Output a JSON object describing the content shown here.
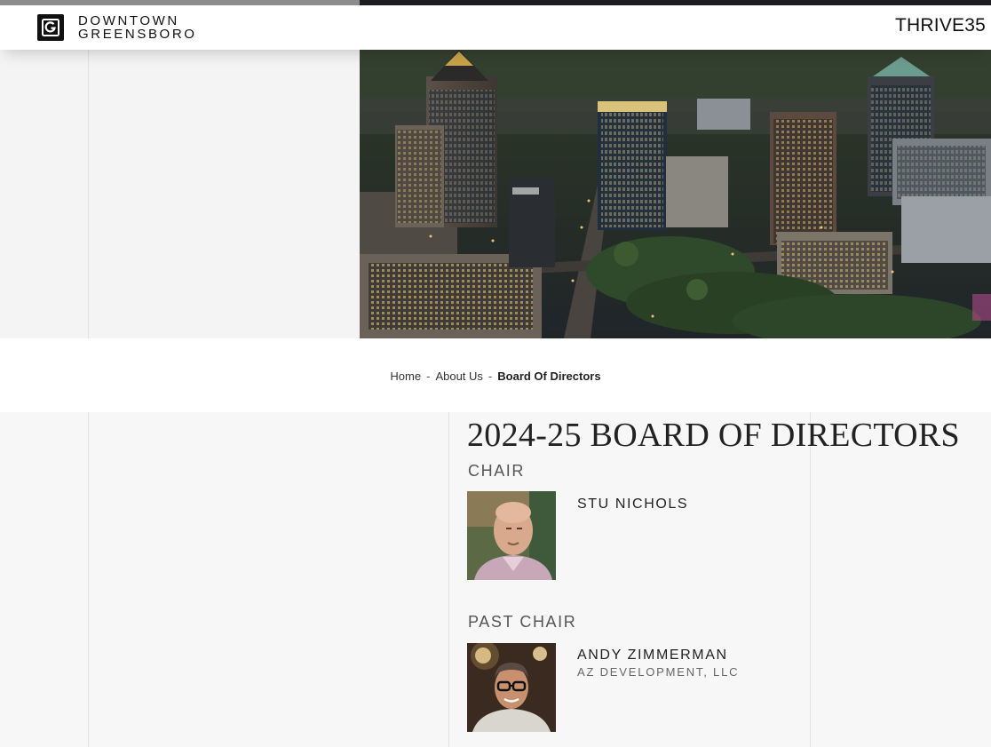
{
  "header": {
    "logo_line1": "DOWNTOWN",
    "logo_line2": "GREENSBORO",
    "logo_icon": "g-box-logo-icon",
    "right_link": "THRIVE35"
  },
  "hero": {
    "image_subject": "aerial city skyline at dusk"
  },
  "breadcrumb": {
    "items": [
      "Home",
      "About Us",
      "Board Of Directors"
    ],
    "separator": "-"
  },
  "page": {
    "title": "2024-25 BOARD OF DIRECTORS"
  },
  "board": [
    {
      "role": "CHAIR",
      "name": "STU NICHOLS",
      "org": ""
    },
    {
      "role": "PAST CHAIR",
      "name": "ANDY ZIMMERMAN",
      "org": "AZ DEVELOPMENT, LLC"
    }
  ],
  "colors": {
    "header_bg": "#ffffff",
    "page_bg": "#f7f7f7",
    "text": "#222222",
    "muted": "#666666"
  }
}
